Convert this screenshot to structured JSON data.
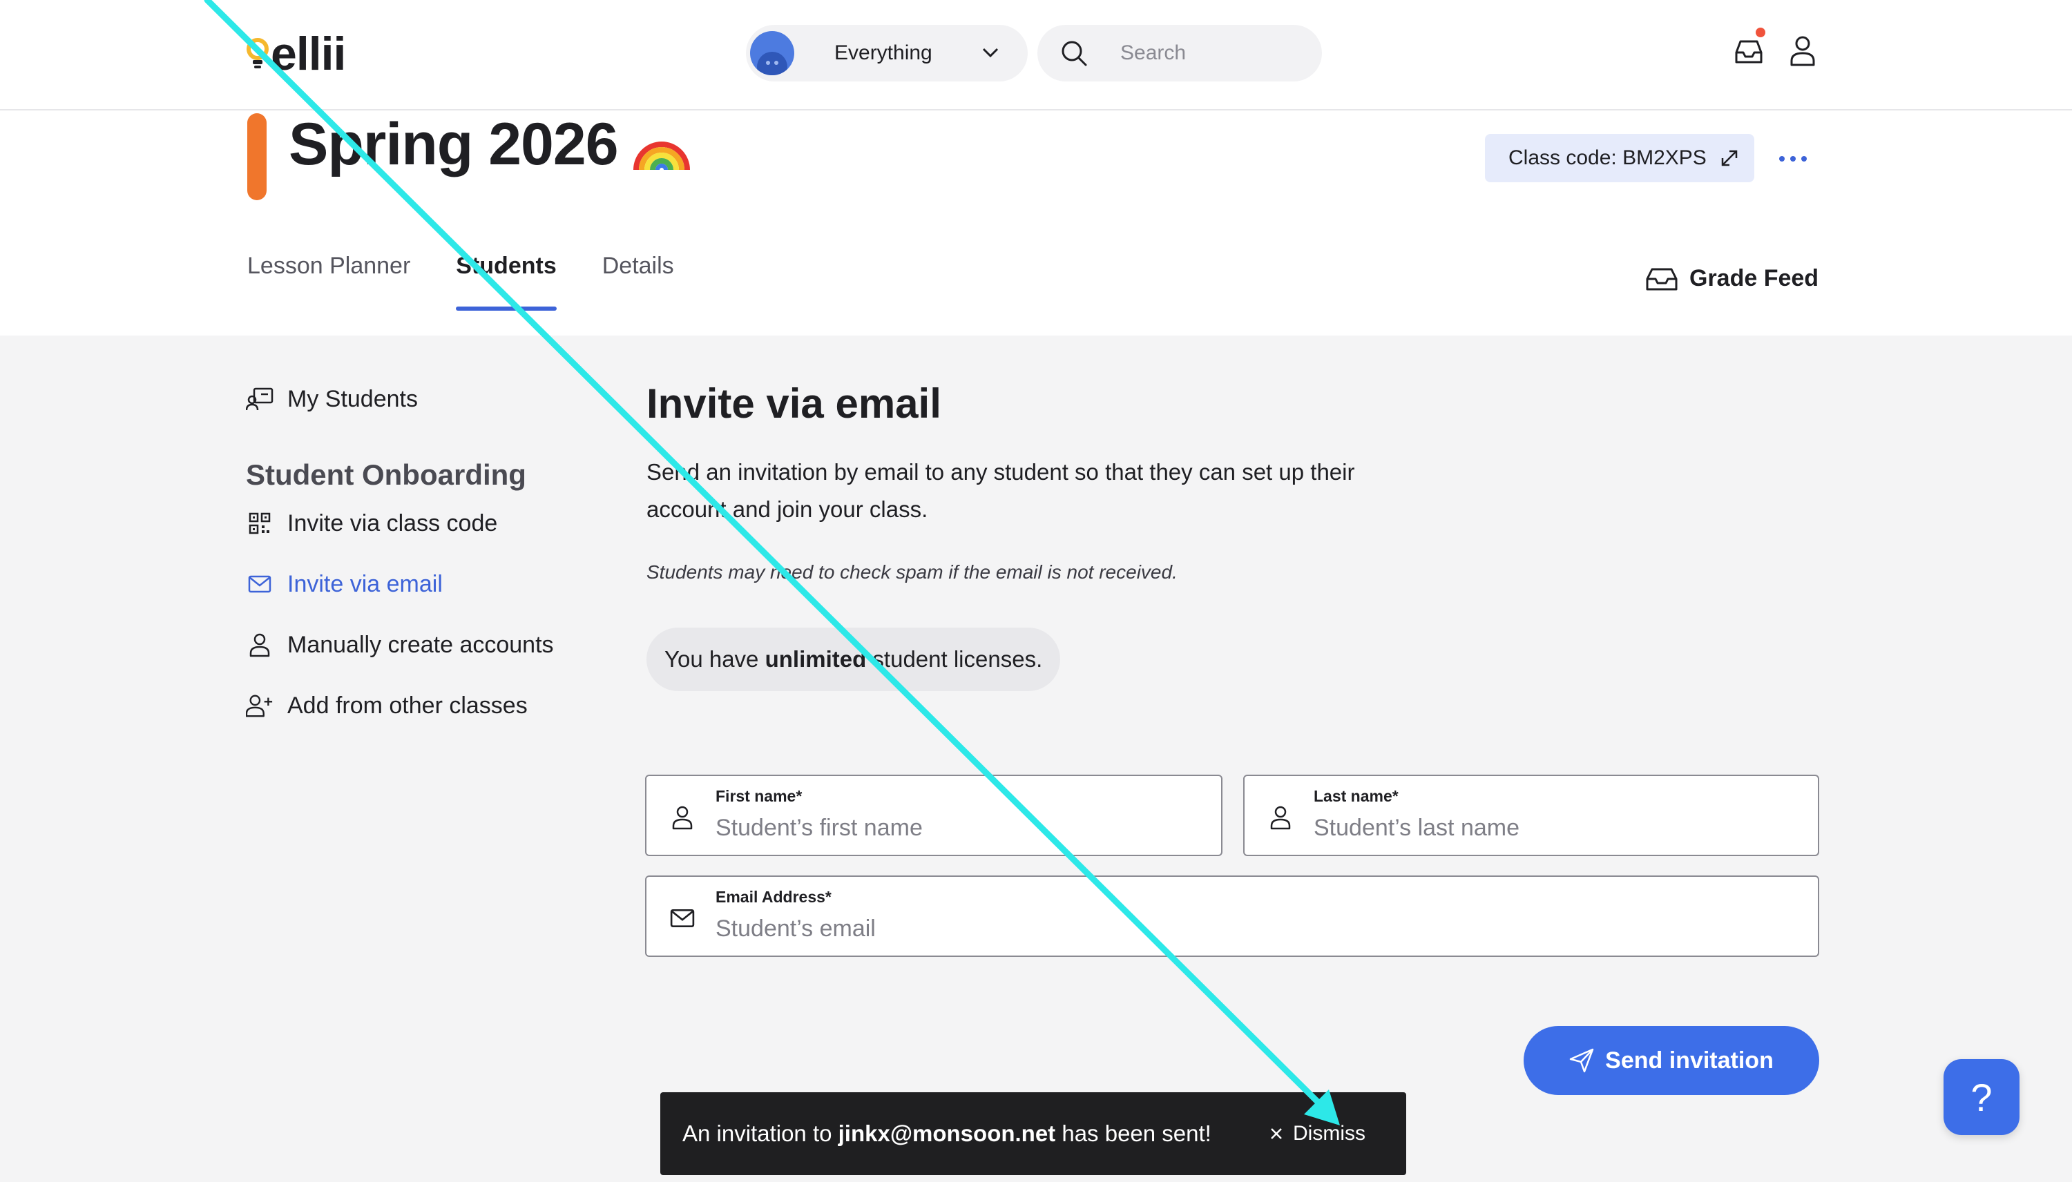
{
  "brand": {
    "name": "ellii",
    "colors": {
      "primary": "#3d6ee8",
      "class_color": "#f0762c",
      "toast_bg": "#1f1f21"
    }
  },
  "topbar": {
    "scope_label": "Everything",
    "search_placeholder": "Search",
    "icons": [
      "inbox-icon",
      "profile-icon",
      "search-icon",
      "chevron-down-icon"
    ]
  },
  "class": {
    "title": "Spring 2026",
    "emoji": "rainbow",
    "code_label": "Class code: BM2XPS"
  },
  "tabs": [
    {
      "label": "Lesson Planner",
      "active": false
    },
    {
      "label": "Students",
      "active": true
    },
    {
      "label": "Details",
      "active": false
    }
  ],
  "grade_feed_label": "Grade Feed",
  "side": {
    "my_students": "My Students",
    "heading": "Student Onboarding",
    "items": [
      {
        "label": "Invite via class code",
        "icon": "qr-code-icon",
        "active": false
      },
      {
        "label": "Invite via email",
        "icon": "mail-icon",
        "active": true
      },
      {
        "label": "Manually create accounts",
        "icon": "user-icon",
        "active": false
      },
      {
        "label": "Add from other classes",
        "icon": "user-plus-icon",
        "active": false
      }
    ]
  },
  "main": {
    "title": "Invite via email",
    "description": "Send an invitation by email to any student so that they can set up their account and join your class.",
    "note": "Students may need to check spam if the email is not received.",
    "license_prefix": "You have ",
    "license_bold": "unlimited",
    "license_suffix": " student licenses."
  },
  "form": {
    "first_name": {
      "label": "First name*",
      "placeholder": "Student’s first name",
      "value": ""
    },
    "last_name": {
      "label": "Last name*",
      "placeholder": "Student’s last name",
      "value": ""
    },
    "email": {
      "label": "Email Address*",
      "placeholder": "Student’s email",
      "value": ""
    },
    "submit_label": "Send invitation"
  },
  "help_label": "?",
  "toast": {
    "prefix": "An invitation to ",
    "email": "jinkx@monsoon.net",
    "suffix": " has been sent!",
    "dismiss_label": "Dismiss"
  }
}
